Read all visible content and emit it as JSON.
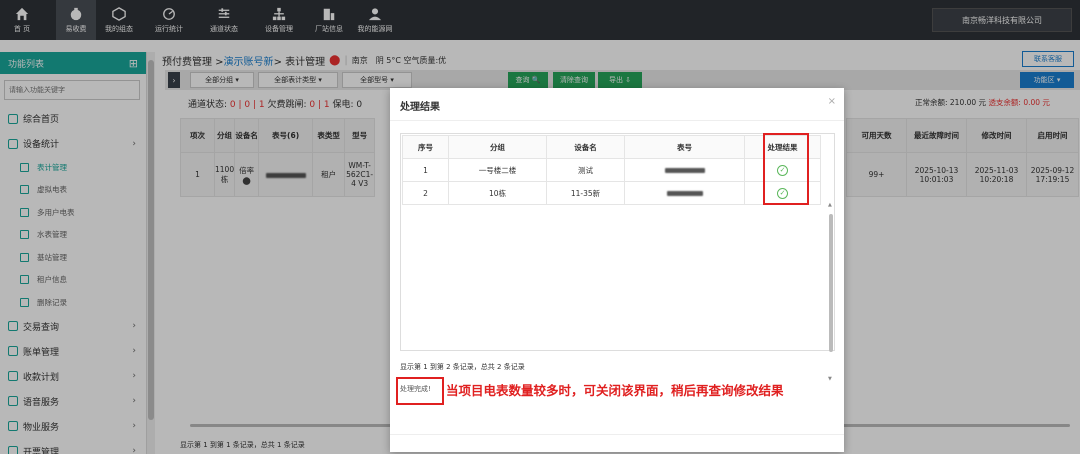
{
  "topnav": {
    "items": [
      {
        "label": "首 页",
        "icon": "home-icon"
      },
      {
        "label": "易收费",
        "icon": "money-bag-icon"
      },
      {
        "label": "我的组态",
        "icon": "cube-icon"
      },
      {
        "label": "运行统计",
        "icon": "gauge-icon"
      },
      {
        "label": "通道状态",
        "icon": "sliders-icon"
      },
      {
        "label": "设备管理",
        "icon": "org-chart-icon"
      },
      {
        "label": "厂站信息",
        "icon": "building-icon"
      },
      {
        "label": "我的能源网",
        "icon": "user-icon"
      }
    ],
    "company": "南京畅洋科技有限公司"
  },
  "sidebar": {
    "title": "功能列表",
    "search_placeholder": "请输入功能关键字",
    "items": [
      {
        "label": "综合首页",
        "type": "main"
      },
      {
        "label": "设备统计",
        "type": "main",
        "arrow": "›"
      },
      {
        "label": "表计管理",
        "type": "sub",
        "active": true
      },
      {
        "label": "虚拟电表",
        "type": "sub"
      },
      {
        "label": "多用户电表",
        "type": "sub"
      },
      {
        "label": "水表管理",
        "type": "sub"
      },
      {
        "label": "基站管理",
        "type": "sub"
      },
      {
        "label": "租户信息",
        "type": "sub"
      },
      {
        "label": "删除记录",
        "type": "sub"
      },
      {
        "label": "交易查询",
        "type": "main",
        "arrow": "›"
      },
      {
        "label": "账单管理",
        "type": "main",
        "arrow": "›"
      },
      {
        "label": "收款计划",
        "type": "main",
        "arrow": "›"
      },
      {
        "label": "语音服务",
        "type": "main",
        "arrow": "›"
      },
      {
        "label": "物业服务",
        "type": "main",
        "arrow": "›"
      },
      {
        "label": "开票管理",
        "type": "main",
        "arrow": "›"
      }
    ]
  },
  "breadcrumb": {
    "part1": "预付费管理 > ",
    "part2": "演示账号新",
    "part3": " > 表计管理",
    "city": "南京",
    "weather": "阴 5°C 空气质量:优"
  },
  "contact_button": "联系客服",
  "toolbar": {
    "select_group": "全部分组 ▾",
    "select_meter_type": "全部表计类型 ▾",
    "select_model": "全部型号 ▾",
    "search": "查询 🔍",
    "clear": "清除查询",
    "export": "导出 ⇩",
    "func": "功能区 ▾"
  },
  "status_line": {
    "prefix": "通道状态: ",
    "a": "0",
    "sep1": " | ",
    "b": "0",
    "sep2": " | ",
    "c": "1",
    "mid": "  欠费跳闸: ",
    "d": "0",
    "sep3": " | ",
    "e": "1",
    "end": "  保电: 0"
  },
  "balance": {
    "normal": "正常余额: 210.00 元",
    "overdraft": "透支余额: 0.00 元"
  },
  "bg_table": {
    "headers": [
      "项次",
      "分组",
      "设备名",
      "表号(6)",
      "表类型",
      "型号"
    ],
    "row": [
      "1",
      "1100\n栋",
      "倍率",
      "",
      "租户",
      "WM-T-\n562C1-\n4 V3"
    ]
  },
  "bg_table_right": {
    "headers": [
      "可用天数",
      "最近故障时间",
      "修改时间",
      "启用时间"
    ],
    "row": [
      "99+",
      "2025-10-13\n10:01:03",
      "2025-11-03\n10:20:18",
      "2025-09-12\n17:19:15"
    ]
  },
  "footer_records": "显示第 1 到第 1 条记录，总共 1 条记录",
  "modal": {
    "title": "处理结果",
    "close": "×",
    "headers": [
      "序号",
      "分组",
      "设备名",
      "表号",
      "处理结果"
    ],
    "rows": [
      {
        "no": "1",
        "group": "一号楼二楼",
        "device": "测试",
        "result": "✓"
      },
      {
        "no": "2",
        "group": "10栋",
        "device": "11-35新",
        "result": "✓"
      }
    ],
    "records": "显示第 1 到第 2 条记录，总共 2 条记录",
    "done": "处理完成!"
  },
  "annotation": "当项目电表数量较多时，可关闭该界面，稍后再查询修改结果",
  "colors": {
    "topbar": "#2f3338",
    "accent": "#1aa89c",
    "link": "#1a7fd0",
    "highlight": "#e02020",
    "success": "#5cb85c"
  }
}
